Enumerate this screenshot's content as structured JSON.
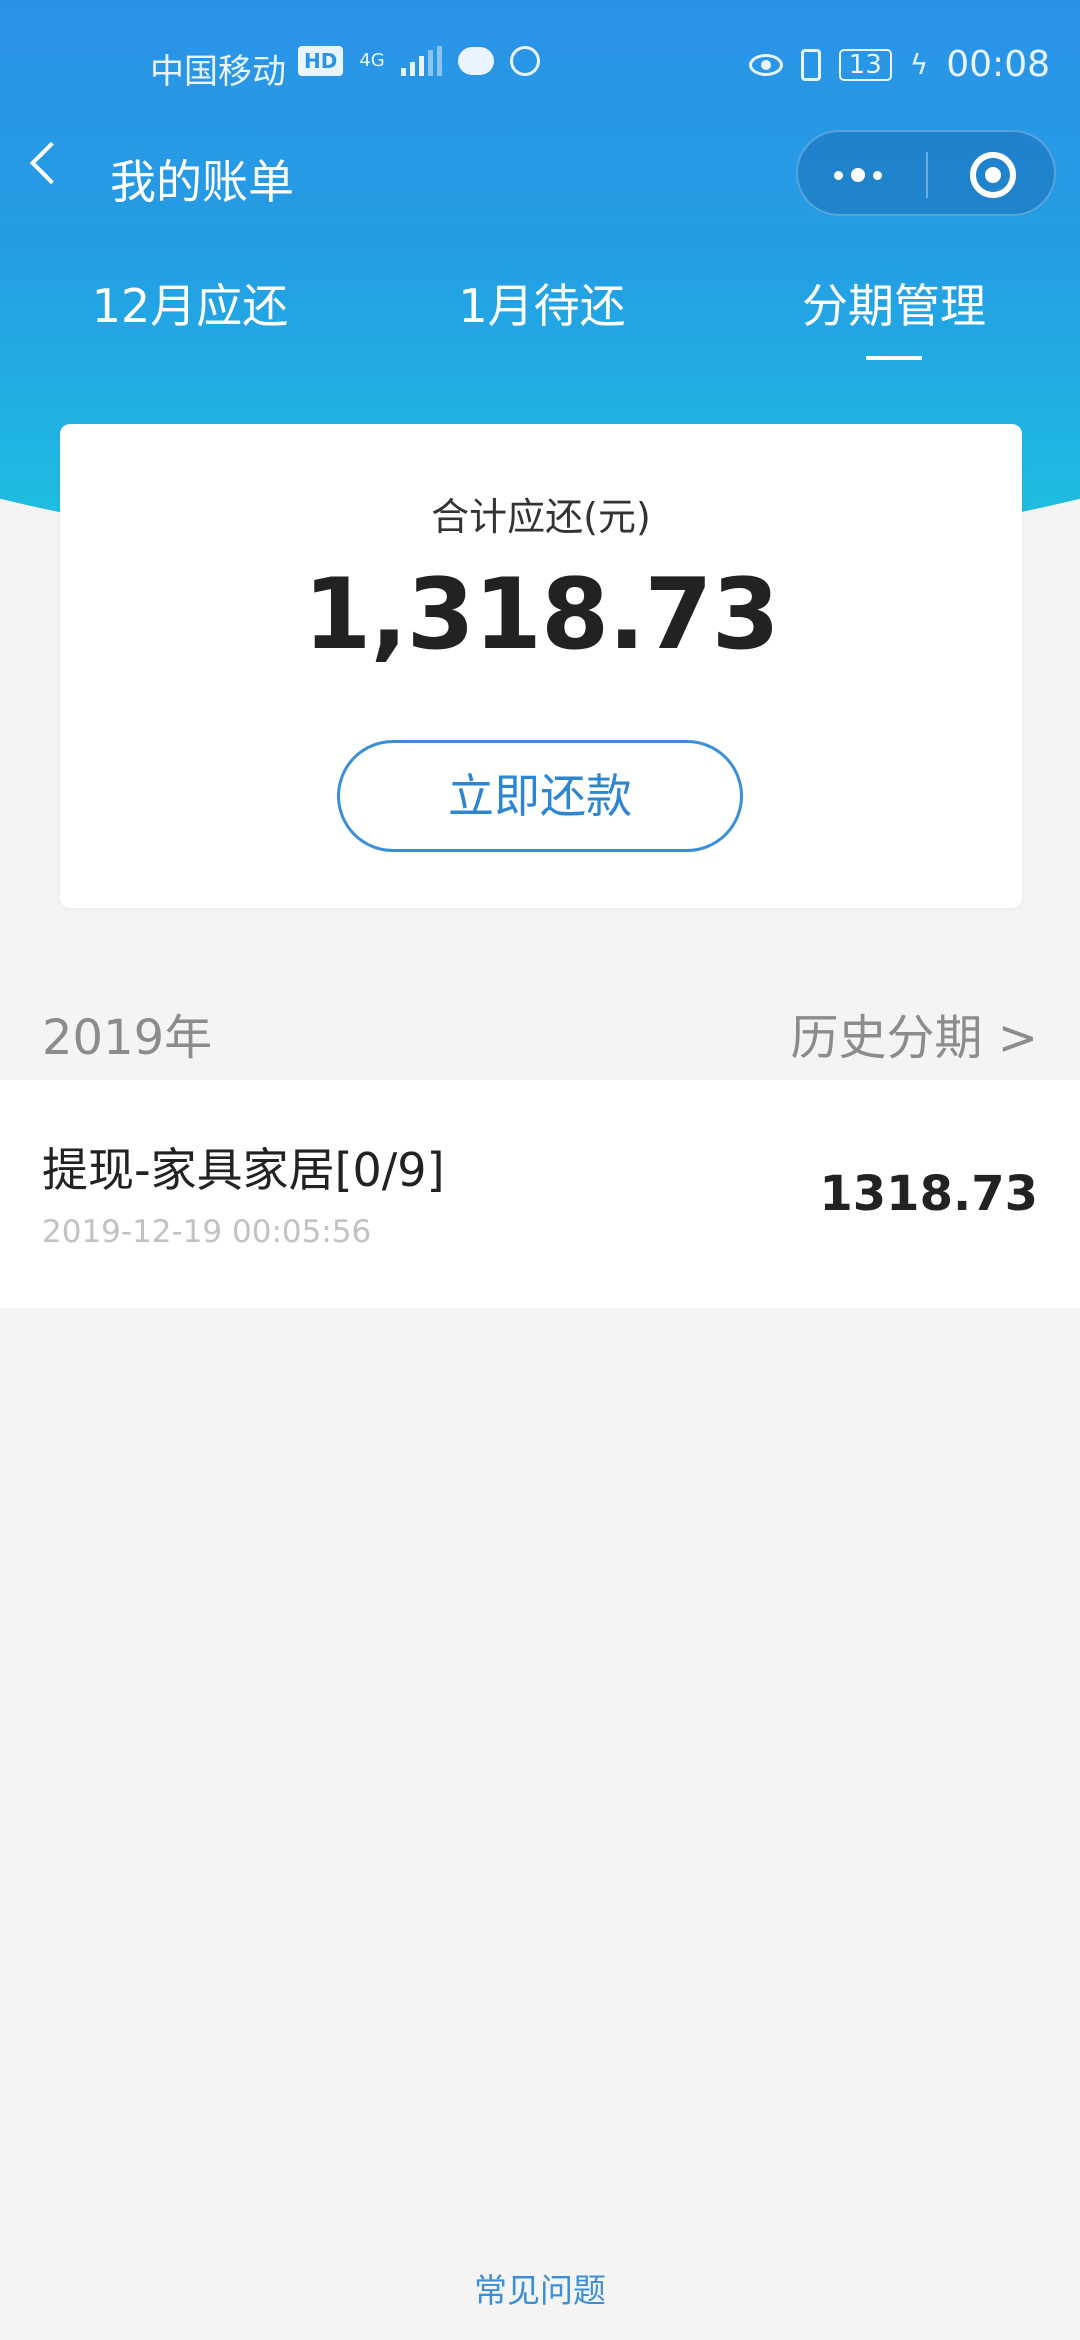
{
  "status_bar": {
    "carrier": "中国移动",
    "hd": "HD",
    "network": "4G",
    "battery": "13",
    "time": "00:08"
  },
  "nav": {
    "title": "我的账单"
  },
  "tabs": [
    {
      "label": "12月应还"
    },
    {
      "label": "1月待还"
    },
    {
      "label": "分期管理"
    }
  ],
  "active_tab": 2,
  "summary": {
    "label": "合计应还(元)",
    "amount": "1,318.73",
    "button": "立即还款"
  },
  "section": {
    "year": "2019年",
    "history_link": "历史分期 >"
  },
  "items": [
    {
      "title": "提现-家具家居[0/9]",
      "date": "2019-12-19 00:05:56",
      "amount": "1318.73"
    }
  ],
  "footer": {
    "faq": "常见问题"
  },
  "colors": {
    "header_top": "#2b93e6",
    "header_bottom": "#1ec3e0",
    "accent": "#3a8fd6"
  }
}
